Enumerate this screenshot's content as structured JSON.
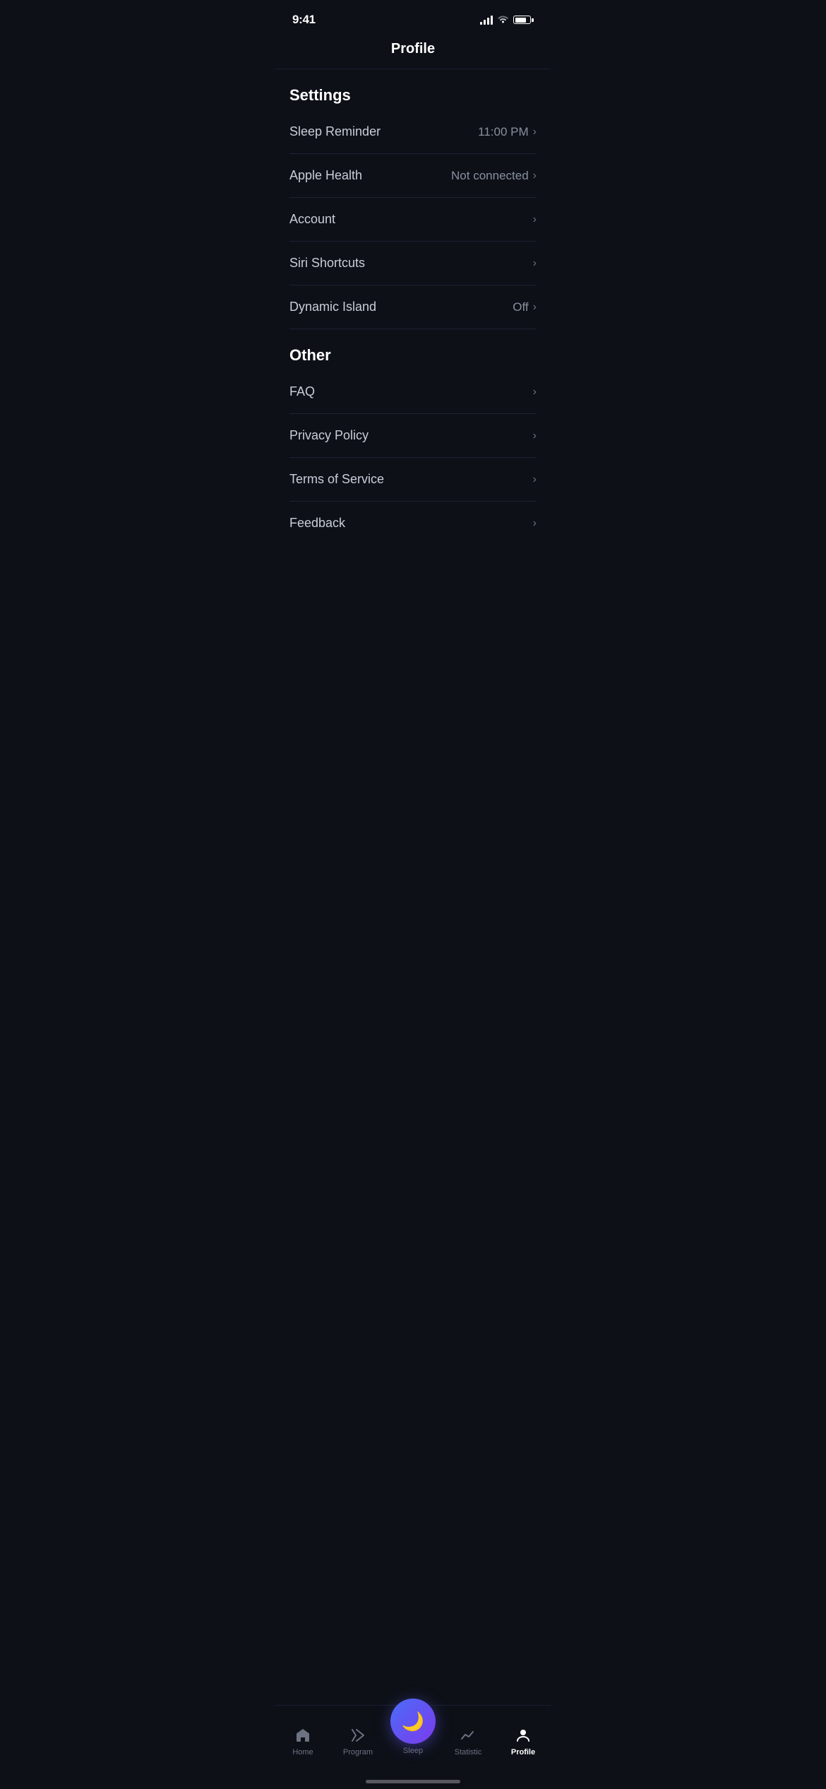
{
  "statusBar": {
    "time": "9:41"
  },
  "header": {
    "title": "Profile"
  },
  "settings": {
    "sectionTitle": "Settings",
    "items": [
      {
        "label": "Sleep Reminder",
        "value": "11:00 PM",
        "hasChevron": true
      },
      {
        "label": "Apple Health",
        "value": "Not connected",
        "hasChevron": true
      },
      {
        "label": "Account",
        "value": "",
        "hasChevron": true
      },
      {
        "label": "Siri Shortcuts",
        "value": "",
        "hasChevron": true
      },
      {
        "label": "Dynamic Island",
        "value": "Off",
        "hasChevron": true
      }
    ]
  },
  "other": {
    "sectionTitle": "Other",
    "items": [
      {
        "label": "FAQ",
        "value": "",
        "hasChevron": true
      },
      {
        "label": "Privacy Policy",
        "value": "",
        "hasChevron": true
      },
      {
        "label": "Terms of Service",
        "value": "",
        "hasChevron": true
      },
      {
        "label": "Feedback",
        "value": "",
        "hasChevron": true
      }
    ]
  },
  "tabBar": {
    "items": [
      {
        "label": "Home",
        "icon": "home",
        "active": false
      },
      {
        "label": "Program",
        "icon": "program",
        "active": false
      },
      {
        "label": "Sleep",
        "icon": "sleep",
        "active": false,
        "isCenter": true
      },
      {
        "label": "Statistic",
        "icon": "statistic",
        "active": false
      },
      {
        "label": "Profile",
        "icon": "profile",
        "active": true
      }
    ]
  }
}
